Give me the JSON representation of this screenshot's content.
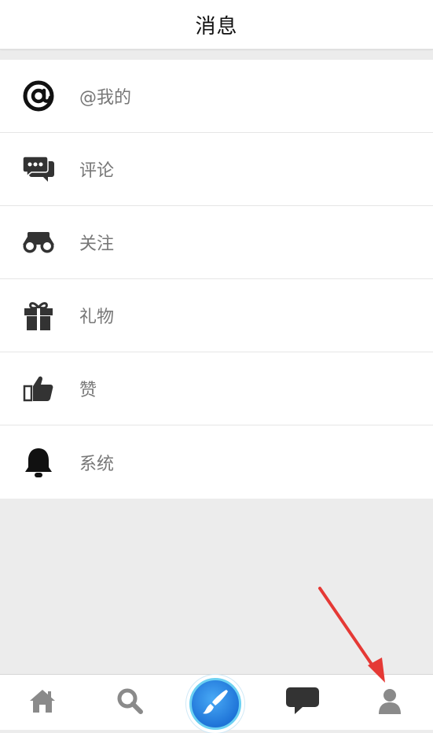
{
  "header": {
    "title": "消息"
  },
  "menu": {
    "items": [
      {
        "label": "@我的",
        "icon": "at-icon"
      },
      {
        "label": "评论",
        "icon": "comment-icon"
      },
      {
        "label": "关注",
        "icon": "binoculars-icon"
      },
      {
        "label": "礼物",
        "icon": "gift-icon"
      },
      {
        "label": "赞",
        "icon": "thumbs-up-icon"
      },
      {
        "label": "系统",
        "icon": "bell-icon"
      }
    ]
  },
  "tabbar": {
    "items": [
      {
        "icon": "home-icon"
      },
      {
        "icon": "search-icon"
      },
      {
        "icon": "brush-icon"
      },
      {
        "icon": "chat-bubble-icon"
      },
      {
        "icon": "profile-icon"
      }
    ]
  },
  "colors": {
    "background": "#ececec",
    "label_text": "#777777",
    "icon_dark": "#333333",
    "tab_icon": "#888888",
    "accent_blue": "#1f74d8",
    "annotation_red": "#e53935"
  }
}
